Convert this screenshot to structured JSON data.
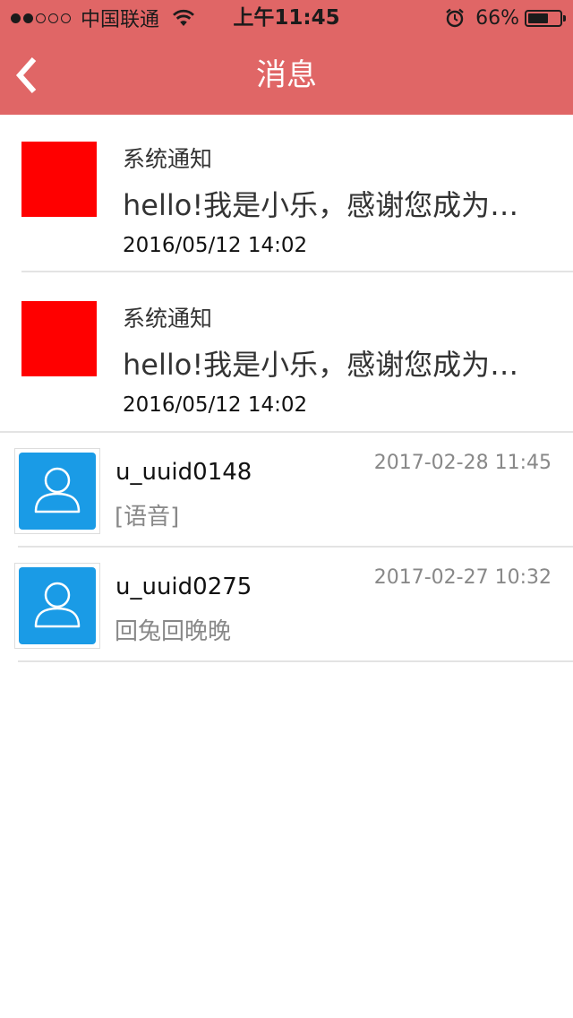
{
  "status_bar": {
    "signal_bars_filled": 2,
    "signal_bars_total": 5,
    "carrier": "中国联通",
    "time": "上午11:45",
    "battery_percent": "66%",
    "battery_level": 0.66
  },
  "nav": {
    "title": "消息",
    "back_icon": "chevron-left-icon"
  },
  "colors": {
    "header_bg": "#e06666",
    "notice_thumb": "#ff0000",
    "avatar_bg": "#1a9be6"
  },
  "notices": [
    {
      "title": "系统通知",
      "body": "hello!我是小乐，感谢您成为我们的用户",
      "date": "2016/05/12 14:02"
    },
    {
      "title": "系统通知",
      "body": "hello!我是小乐，感谢您成为我们的用户",
      "date": "2016/05/12 14:02"
    }
  ],
  "chats": [
    {
      "name": "u_uuid0148",
      "time": "2017-02-28 11:45",
      "message": "[语音]"
    },
    {
      "name": "u_uuid0275",
      "time": "2017-02-27 10:32",
      "message": " 回兔回晚晚"
    }
  ]
}
